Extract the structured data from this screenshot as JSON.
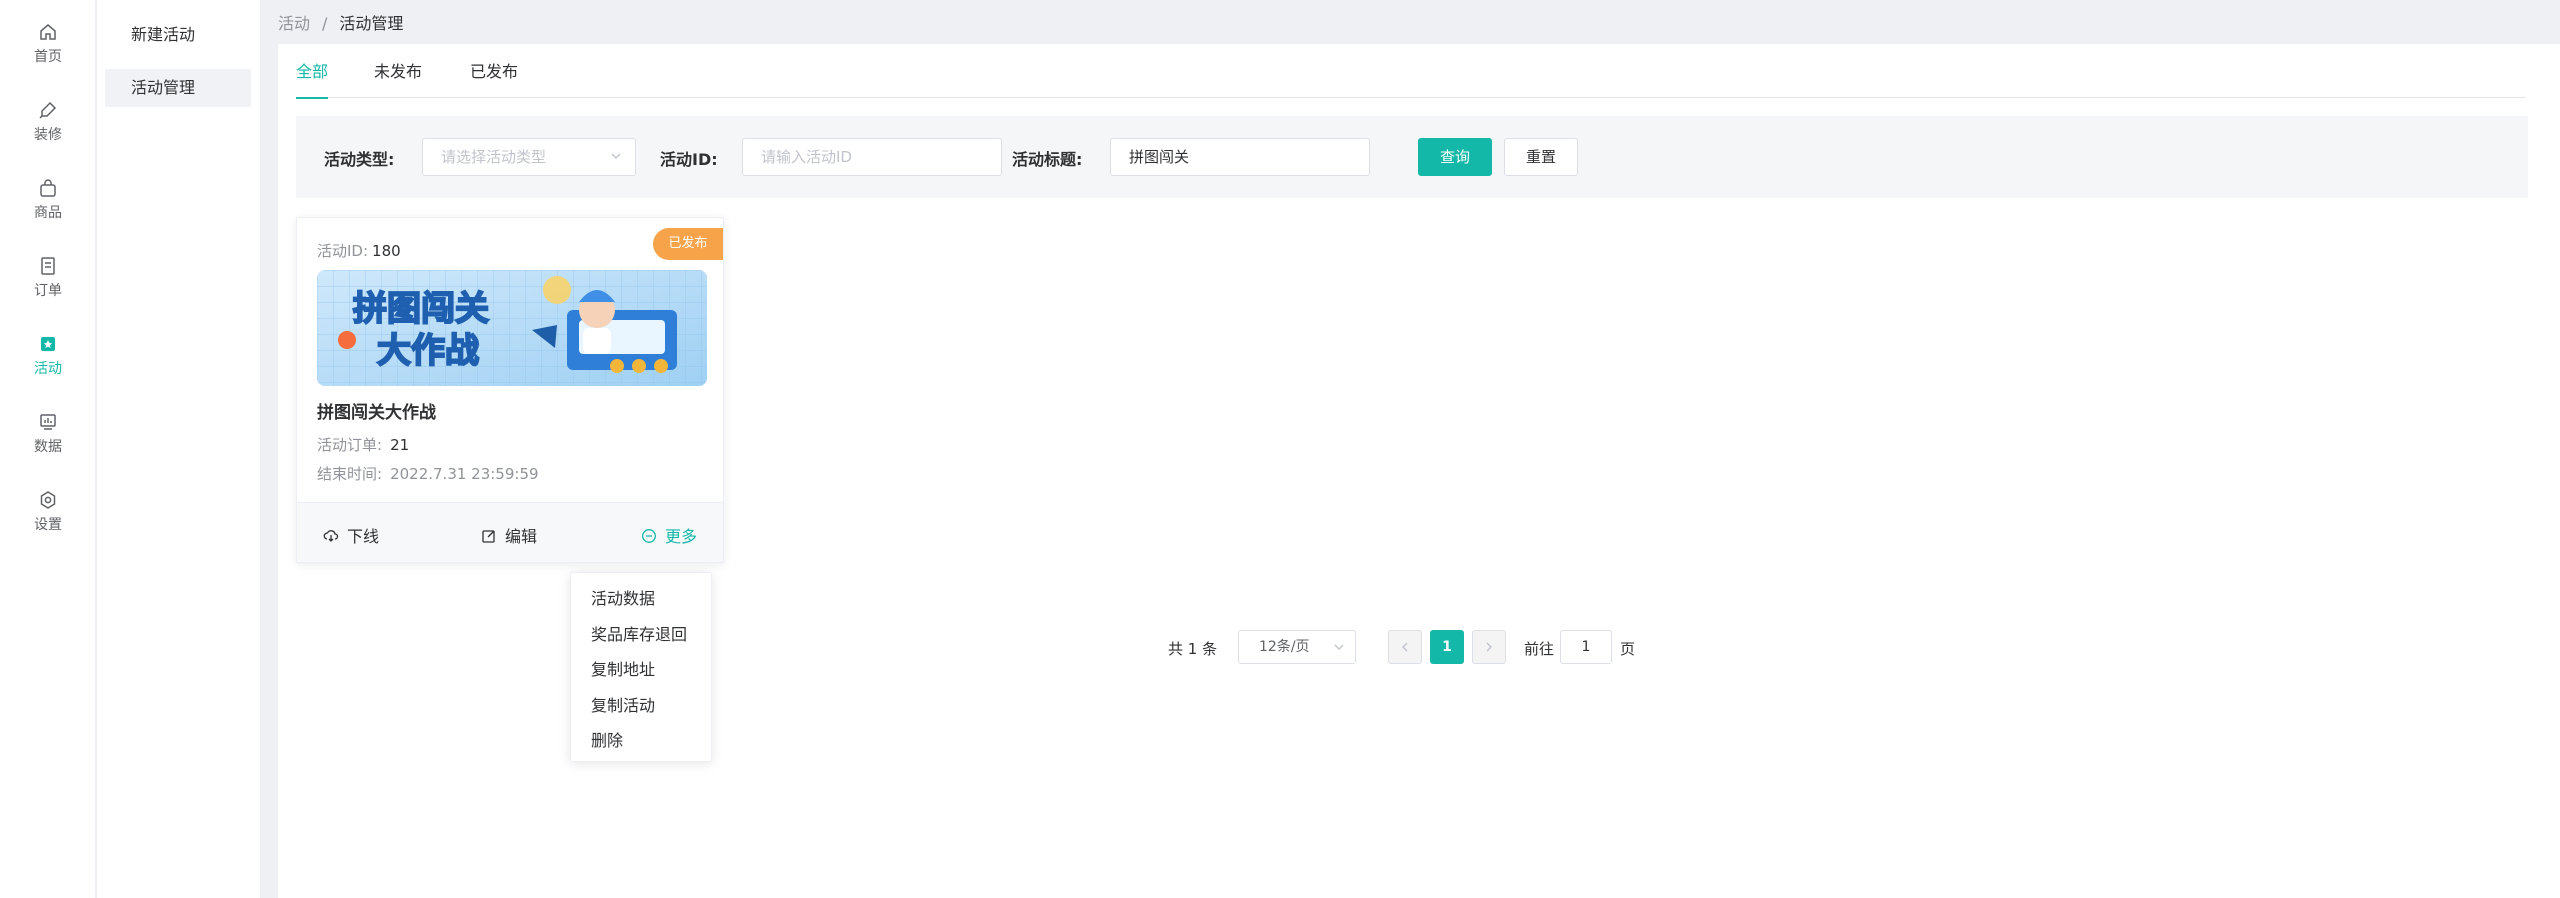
{
  "rail": [
    {
      "label": "首页",
      "icon": "home-icon"
    },
    {
      "label": "装修",
      "icon": "brush-icon"
    },
    {
      "label": "商品",
      "icon": "bag-icon"
    },
    {
      "label": "订单",
      "icon": "order-icon"
    },
    {
      "label": "活动",
      "icon": "activity-icon",
      "active": true
    },
    {
      "label": "数据",
      "icon": "data-icon"
    },
    {
      "label": "设置",
      "icon": "settings-icon"
    }
  ],
  "submenu": [
    {
      "label": "新建活动"
    },
    {
      "label": "活动管理",
      "active": true
    }
  ],
  "breadcrumb": {
    "root": "活动",
    "sep": "/",
    "current": "活动管理"
  },
  "tabs": [
    {
      "label": "全部",
      "active": true
    },
    {
      "label": "未发布"
    },
    {
      "label": "已发布"
    }
  ],
  "filter": {
    "type_label": "活动类型:",
    "type_placeholder": "请选择活动类型",
    "id_label": "活动ID:",
    "id_placeholder": "请输入活动ID",
    "title_label": "活动标题:",
    "title_value": "拼图闯关",
    "query_btn": "查询",
    "reset_btn": "重置"
  },
  "card": {
    "id_label": "活动ID:",
    "id_value": "180",
    "badge": "已发布",
    "banner_line1": "拼图闯关",
    "banner_line2": "大作战",
    "title": "拼图闯关大作战",
    "orders_label": "活动订单:",
    "orders_value": "21",
    "end_label": "结束时间:",
    "end_value": "2022.7.31 23:59:59",
    "offline_label": "下线",
    "edit_label": "编辑",
    "more_label": "更多"
  },
  "more_menu": [
    "活动数据",
    "奖品库存退回",
    "复制地址",
    "复制活动",
    "删除"
  ],
  "pagination": {
    "total": "共 1 条",
    "page_size": "12条/页",
    "current": "1",
    "goto_label": "前往",
    "goto_value": "1",
    "goto_unit": "页"
  },
  "colors": {
    "accent": "#13b8a8",
    "badge": "#f7a34a"
  }
}
